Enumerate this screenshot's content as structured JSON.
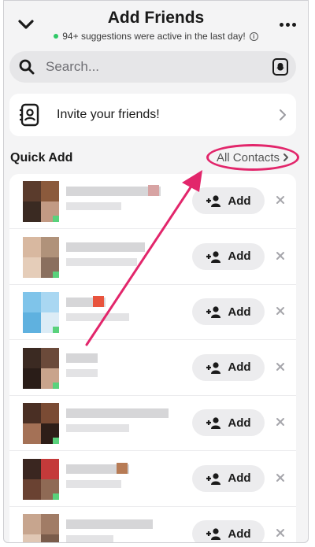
{
  "header": {
    "title": "Add Friends",
    "subtitle": "94+ suggestions were active in the last day!"
  },
  "search": {
    "placeholder": "Search..."
  },
  "invite": {
    "label": "Invite your friends!"
  },
  "quick_add": {
    "title": "Quick Add",
    "all_contacts": "All Contacts",
    "add_label": "Add",
    "rows": [
      {
        "avatar_colors": [
          "#5a3b2c",
          "#8b5a3c",
          "#3a2a22",
          "#c29a84"
        ],
        "accent": "#d7a3a3"
      },
      {
        "avatar_colors": [
          "#d8b8a0",
          "#b0927a",
          "#e5cdb9",
          "#8a6f5e"
        ],
        "accent": ""
      },
      {
        "avatar_colors": [
          "#7fc4ea",
          "#a9d7f2",
          "#5fb1df",
          "#dcecf6"
        ],
        "accent": "#e8533d"
      },
      {
        "avatar_colors": [
          "#3b2a22",
          "#6b4a3a",
          "#2a1d18",
          "#c9a48c"
        ],
        "accent": ""
      },
      {
        "avatar_colors": [
          "#4a2f24",
          "#7a4b34",
          "#a47156",
          "#2e1e18"
        ],
        "accent": ""
      },
      {
        "avatar_colors": [
          "#3a2620",
          "#c43a3a",
          "#6a4232",
          "#8f6a55"
        ],
        "accent": "#b77b55"
      },
      {
        "avatar_colors": [
          "#c7a58e",
          "#a17c66",
          "#e0c7b4",
          "#7a5c4b"
        ],
        "accent": ""
      }
    ]
  },
  "colors": {
    "annotation": "#e2266b",
    "online": "#59d27c",
    "active_dot": "#2ec866"
  }
}
